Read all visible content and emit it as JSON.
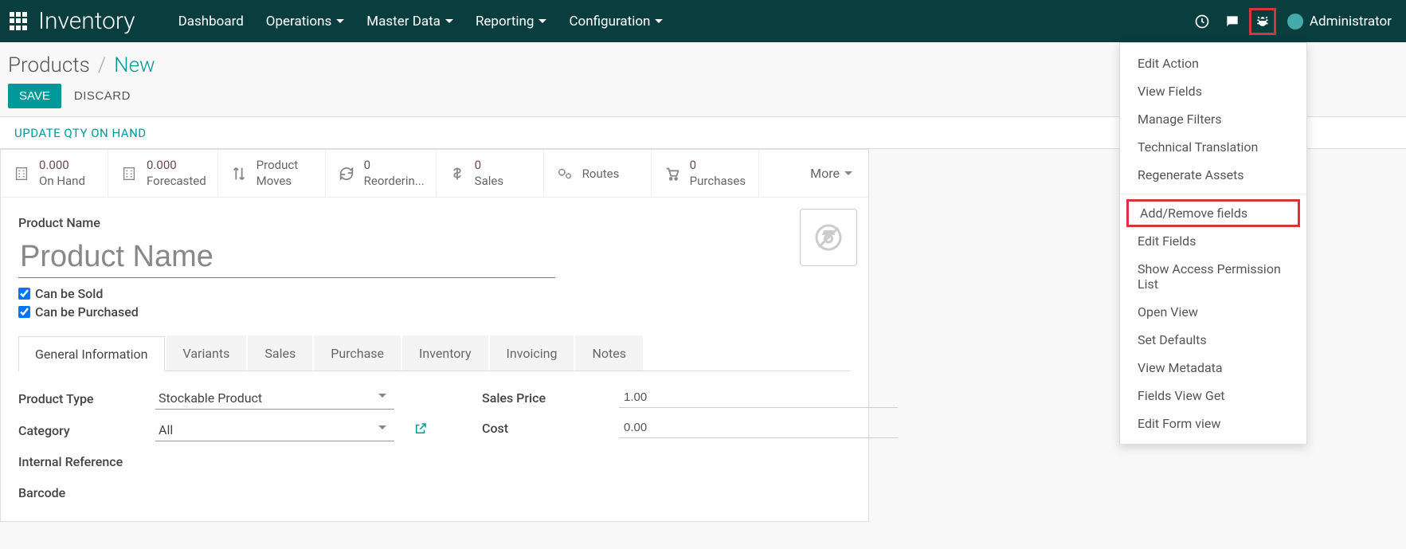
{
  "topbar": {
    "brand": "Inventory",
    "nav": [
      "Dashboard",
      "Operations",
      "Master Data",
      "Reporting",
      "Configuration"
    ],
    "user": "Administrator"
  },
  "breadcrumb": {
    "parent": "Products",
    "current": "New"
  },
  "actions": {
    "save": "SAVE",
    "discard": "DISCARD"
  },
  "statusbar": {
    "update_qty": "UPDATE QTY ON HAND"
  },
  "stats": {
    "on_hand": {
      "value": "0.000",
      "label": "On Hand"
    },
    "forecasted": {
      "value": "0.000",
      "label": "Forecasted"
    },
    "moves": {
      "label1": "Product",
      "label2": "Moves"
    },
    "reordering": {
      "value": "0",
      "label": "Reorderin..."
    },
    "sales": {
      "value": "0",
      "label": "Sales"
    },
    "routes": {
      "label": "Routes"
    },
    "purchases": {
      "value": "0",
      "label": "Purchases"
    },
    "more": "More"
  },
  "form": {
    "product_name_label": "Product Name",
    "product_name_placeholder": "Product Name",
    "can_sold": "Can be Sold",
    "can_purchased": "Can be Purchased"
  },
  "tabs": [
    "General Information",
    "Variants",
    "Sales",
    "Purchase",
    "Inventory",
    "Invoicing",
    "Notes"
  ],
  "fields": {
    "product_type": {
      "label": "Product Type",
      "value": "Stockable Product"
    },
    "category": {
      "label": "Category",
      "value": "All"
    },
    "internal_ref": {
      "label": "Internal Reference"
    },
    "barcode": {
      "label": "Barcode"
    },
    "sales_price": {
      "label": "Sales Price",
      "value": "1.00"
    },
    "cost": {
      "label": "Cost",
      "value": "0.00"
    }
  },
  "dev_menu": {
    "group1": [
      "Edit Action",
      "View Fields",
      "Manage Filters",
      "Technical Translation",
      "Regenerate Assets"
    ],
    "highlighted": "Add/Remove fields",
    "group2": [
      "Edit Fields",
      "Show Access Permission List",
      "Open View",
      "Set Defaults",
      "View Metadata",
      "Fields View Get",
      "Edit Form view"
    ]
  }
}
